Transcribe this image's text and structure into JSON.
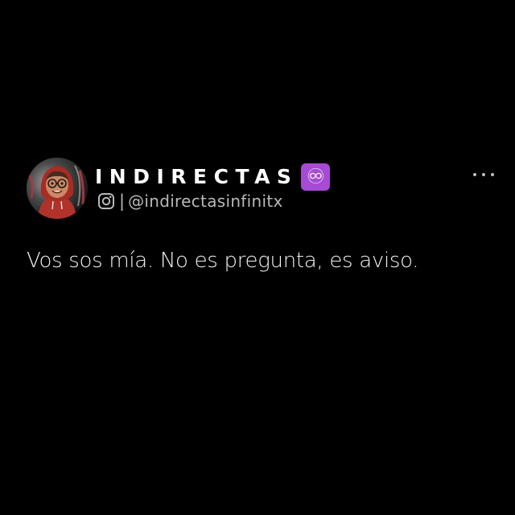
{
  "post": {
    "author": {
      "display_name": "INDIRECTAS",
      "badge_emoji": "♾",
      "separator": "|",
      "handle": "@indirectasinfinitx",
      "avatar_icon": "cartoon-avatar-icon",
      "platform_icon": "instagram-icon"
    },
    "menu_icon": "more-options-icon",
    "text": "Vos sos mía. No es pregunta, es aviso."
  },
  "colors": {
    "background": "#000000",
    "text": "#ffffff",
    "handle": "#b8b8b8",
    "badge": "#a64bd4"
  }
}
